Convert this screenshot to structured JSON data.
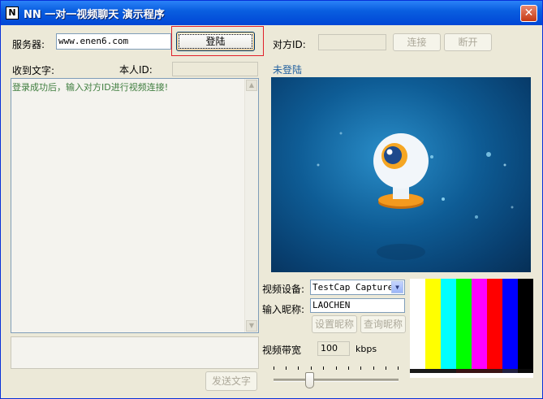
{
  "window": {
    "title": "NN 一对一视频聊天 演示程序",
    "icon_label": "N",
    "close_label": "✕"
  },
  "server": {
    "label": "服务器:",
    "value": "www.enen6.com",
    "login_label": "登陆"
  },
  "peer": {
    "label": "对方ID:",
    "value": "",
    "connect_label": "连接",
    "disconnect_label": "断开"
  },
  "chat": {
    "received_label": "收到文字:",
    "my_id_label": "本人ID:",
    "my_id_value": "",
    "message": "登录成功后，输入对方ID进行视频连接!",
    "input_value": "",
    "send_label": "发送文字"
  },
  "video": {
    "status": "未登陆",
    "device_label": "视频设备:",
    "device_value": "TestCap Capture",
    "nickname_label": "输入昵称:",
    "nickname_value": "LAOCHEN",
    "set_nickname_label": "设置昵称",
    "query_nickname_label": "查询昵称",
    "bandwidth_label": "视频带宽",
    "bandwidth_value": "100",
    "bandwidth_unit": "kbps",
    "bandwidth_slider_fraction": 0.27
  },
  "preview": {
    "bar_colors": [
      "#FFFFFF",
      "#FFFF00",
      "#00FFFF",
      "#00FF00",
      "#FF00FF",
      "#FF0000",
      "#0000FF",
      "#000000"
    ],
    "bottom_colors": [
      "#1A1A1A",
      "#1A1A1A",
      "#1A1A1A",
      "#3A1414",
      "#3A1414",
      "#3A1414",
      "#202040",
      "#0A0A0A"
    ]
  },
  "colors": {
    "title_bar": "#0A5FE0",
    "login_highlight": "#E0202A",
    "message_text": "#3E7D3E",
    "status_text": "#1E5E9E"
  }
}
